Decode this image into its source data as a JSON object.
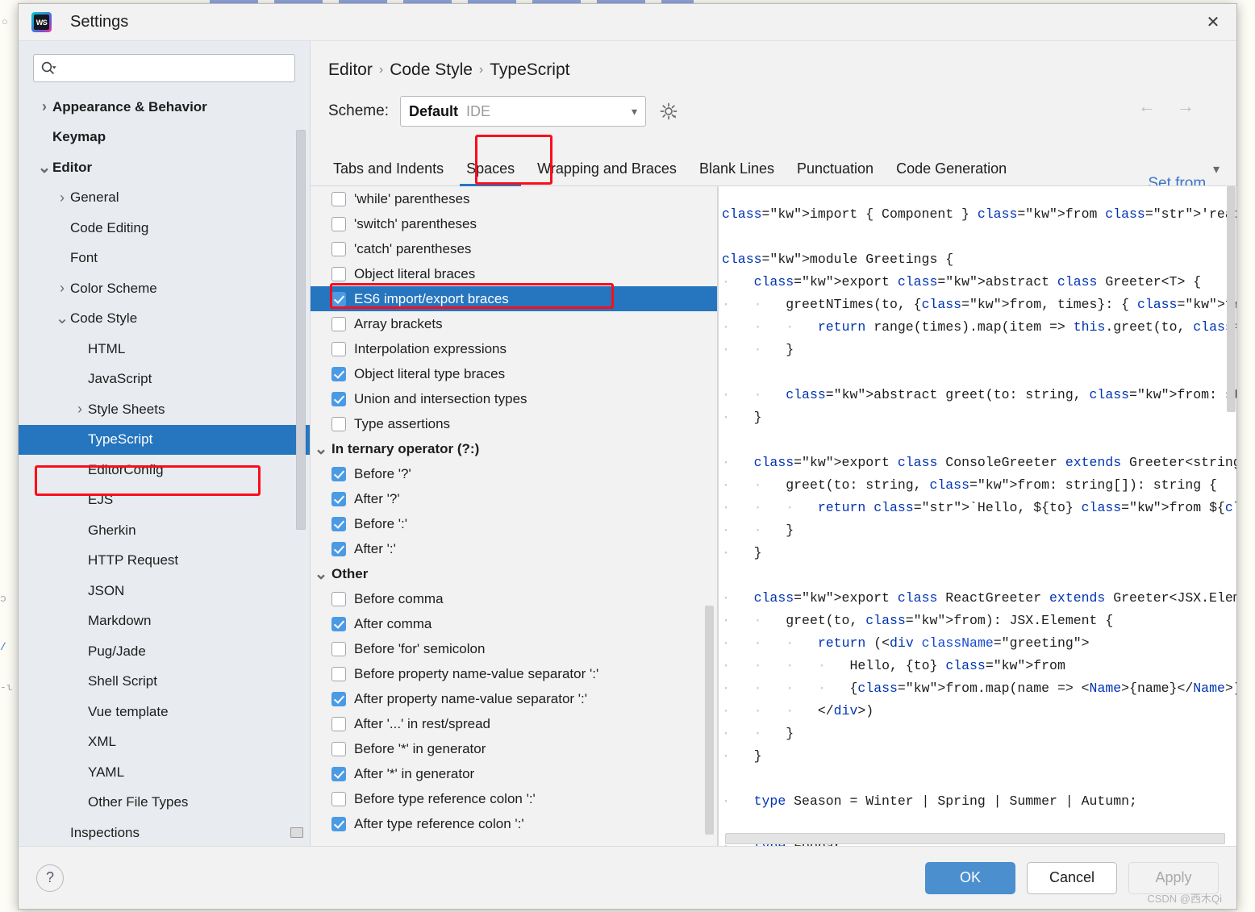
{
  "window": {
    "title": "Settings",
    "app_icon": "webstorm-logo-icon",
    "close_icon": "close-icon"
  },
  "search": {
    "value": "",
    "placeholder": "",
    "icon": "search-icon"
  },
  "sidebar": {
    "items": [
      {
        "label": "Appearance & Behavior",
        "arrow": "collapsed",
        "indent": 0,
        "bold": true,
        "selected": false
      },
      {
        "label": "Keymap",
        "arrow": "none",
        "indent": 0,
        "bold": true,
        "selected": false
      },
      {
        "label": "Editor",
        "arrow": "expanded",
        "indent": 0,
        "bold": true,
        "selected": false
      },
      {
        "label": "General",
        "arrow": "collapsed",
        "indent": 1,
        "bold": false,
        "selected": false
      },
      {
        "label": "Code Editing",
        "arrow": "none",
        "indent": 1,
        "bold": false,
        "selected": false
      },
      {
        "label": "Font",
        "arrow": "none",
        "indent": 1,
        "bold": false,
        "selected": false
      },
      {
        "label": "Color Scheme",
        "arrow": "collapsed",
        "indent": 1,
        "bold": false,
        "selected": false
      },
      {
        "label": "Code Style",
        "arrow": "expanded",
        "indent": 1,
        "bold": false,
        "selected": false
      },
      {
        "label": "HTML",
        "arrow": "none",
        "indent": 2,
        "bold": false,
        "selected": false
      },
      {
        "label": "JavaScript",
        "arrow": "none",
        "indent": 2,
        "bold": false,
        "selected": false
      },
      {
        "label": "Style Sheets",
        "arrow": "collapsed",
        "indent": 2,
        "bold": false,
        "selected": false
      },
      {
        "label": "TypeScript",
        "arrow": "none",
        "indent": 2,
        "bold": false,
        "selected": true
      },
      {
        "label": "EditorConfig",
        "arrow": "none",
        "indent": 2,
        "bold": false,
        "selected": false
      },
      {
        "label": "EJS",
        "arrow": "none",
        "indent": 2,
        "bold": false,
        "selected": false
      },
      {
        "label": "Gherkin",
        "arrow": "none",
        "indent": 2,
        "bold": false,
        "selected": false
      },
      {
        "label": "HTTP Request",
        "arrow": "none",
        "indent": 2,
        "bold": false,
        "selected": false
      },
      {
        "label": "JSON",
        "arrow": "none",
        "indent": 2,
        "bold": false,
        "selected": false
      },
      {
        "label": "Markdown",
        "arrow": "none",
        "indent": 2,
        "bold": false,
        "selected": false
      },
      {
        "label": "Pug/Jade",
        "arrow": "none",
        "indent": 2,
        "bold": false,
        "selected": false
      },
      {
        "label": "Shell Script",
        "arrow": "none",
        "indent": 2,
        "bold": false,
        "selected": false
      },
      {
        "label": "Vue template",
        "arrow": "none",
        "indent": 2,
        "bold": false,
        "selected": false
      },
      {
        "label": "XML",
        "arrow": "none",
        "indent": 2,
        "bold": false,
        "selected": false
      },
      {
        "label": "YAML",
        "arrow": "none",
        "indent": 2,
        "bold": false,
        "selected": false
      },
      {
        "label": "Other File Types",
        "arrow": "none",
        "indent": 2,
        "bold": false,
        "selected": false
      },
      {
        "label": "Inspections",
        "arrow": "none",
        "indent": 1,
        "bold": false,
        "selected": false,
        "badge": true
      }
    ]
  },
  "header": {
    "breadcrumb": [
      "Editor",
      "Code Style",
      "TypeScript"
    ],
    "separator": "›",
    "back_icon": "arrow-left-icon",
    "forward_icon": "arrow-right-icon",
    "scheme_label": "Scheme:",
    "scheme_value": "Default",
    "scheme_scope": "IDE",
    "scheme_chevron": "chevron-down-icon",
    "scheme_gear": "gear-icon",
    "set_from_label": "Set from..."
  },
  "tabs": {
    "items": [
      {
        "label": "Tabs and Indents",
        "active": false
      },
      {
        "label": "Spaces",
        "active": true
      },
      {
        "label": "Wrapping and Braces",
        "active": false
      },
      {
        "label": "Blank Lines",
        "active": false
      },
      {
        "label": "Punctuation",
        "active": false
      },
      {
        "label": "Code Generation",
        "active": false
      }
    ],
    "overflow_icon": "chevron-down-icon"
  },
  "options": [
    {
      "label": "'while' parentheses",
      "type": "check",
      "checked": false,
      "selected": false
    },
    {
      "label": "'switch' parentheses",
      "type": "check",
      "checked": false,
      "selected": false
    },
    {
      "label": "'catch' parentheses",
      "type": "check",
      "checked": false,
      "selected": false
    },
    {
      "label": "Object literal braces",
      "type": "check",
      "checked": false,
      "selected": false
    },
    {
      "label": "ES6 import/export braces",
      "type": "check",
      "checked": true,
      "selected": true
    },
    {
      "label": "Array brackets",
      "type": "check",
      "checked": false,
      "selected": false
    },
    {
      "label": "Interpolation expressions",
      "type": "check",
      "checked": false,
      "selected": false
    },
    {
      "label": "Object literal type braces",
      "type": "check",
      "checked": true,
      "selected": false
    },
    {
      "label": "Union and intersection types",
      "type": "check",
      "checked": true,
      "selected": false
    },
    {
      "label": "Type assertions",
      "type": "check",
      "checked": false,
      "selected": false
    },
    {
      "label": "In ternary operator (?:)",
      "type": "group",
      "expanded": true
    },
    {
      "label": "Before '?'",
      "type": "check",
      "checked": true,
      "selected": false
    },
    {
      "label": "After '?'",
      "type": "check",
      "checked": true,
      "selected": false
    },
    {
      "label": "Before ':'",
      "type": "check",
      "checked": true,
      "selected": false
    },
    {
      "label": "After ':'",
      "type": "check",
      "checked": true,
      "selected": false
    },
    {
      "label": "Other",
      "type": "group",
      "expanded": true
    },
    {
      "label": "Before comma",
      "type": "check",
      "checked": false,
      "selected": false
    },
    {
      "label": "After comma",
      "type": "check",
      "checked": true,
      "selected": false
    },
    {
      "label": "Before 'for' semicolon",
      "type": "check",
      "checked": false,
      "selected": false
    },
    {
      "label": "Before property name-value separator ':'",
      "type": "check",
      "checked": false,
      "selected": false
    },
    {
      "label": "After property name-value separator ':'",
      "type": "check",
      "checked": true,
      "selected": false
    },
    {
      "label": "After '...' in rest/spread",
      "type": "check",
      "checked": false,
      "selected": false
    },
    {
      "label": "Before '*' in generator",
      "type": "check",
      "checked": false,
      "selected": false
    },
    {
      "label": "After '*' in generator",
      "type": "check",
      "checked": true,
      "selected": false
    },
    {
      "label": "Before type reference colon ':'",
      "type": "check",
      "checked": false,
      "selected": false
    },
    {
      "label": "After type reference colon ':'",
      "type": "check",
      "checked": true,
      "selected": false
    }
  ],
  "preview": {
    "code_lines": [
      "import { Component } from 'react'",
      "",
      "module Greetings {",
      "    export abstract class Greeter<T> {",
      "        greetNTimes(to, {from, times}: { from: string[], times:",
      "            return range(times).map(item => this.greet(to, from)",
      "        }",
      "",
      "        abstract greet(to: string, from: string[]): T",
      "    }",
      "",
      "    export class ConsoleGreeter extends Greeter<string> {",
      "        greet(to: string, from: string[]): string {",
      "            return `Hello, ${to} from ${from.join(',')}`",
      "        }",
      "    }",
      "",
      "    export class ReactGreeter extends Greeter<JSX.Element> {",
      "        greet(to, from): JSX.Element {",
      "            return (<div className=\"greeting\">",
      "                Hello, {to} from",
      "                {from.map(name => <Name>{name}</Name>)}",
      "            </div>)",
      "        }",
      "    }",
      "",
      "    type Season = Winter | Spring | Summer | Autumn;",
      "",
      "    type Foobar ="
    ]
  },
  "footer": {
    "help_label": "?",
    "ok_label": "OK",
    "cancel_label": "Cancel",
    "apply_label": "Apply",
    "apply_disabled": true,
    "watermark": "CSDN @西木Qi"
  },
  "annotations": {
    "typescript_box": "red-highlight-box",
    "spaces_tab_box": "red-highlight-box",
    "es6_option_box": "red-highlight-box"
  },
  "colors": {
    "accent": "#2675bf",
    "checkbox": "#4b9ae4",
    "annotation": "#fc0d1b",
    "link": "#3a76c8",
    "sidebar_bg": "#e8ecf0"
  }
}
